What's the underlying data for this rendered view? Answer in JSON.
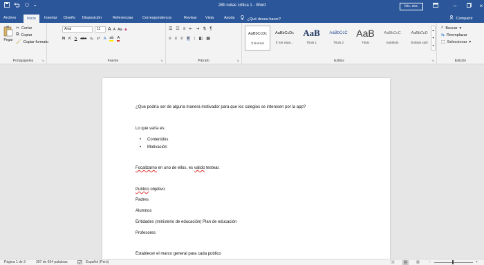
{
  "title_bar": {
    "document_title": "28h notas crítica 1 - Word",
    "signin_label": "Inic. ses.",
    "qat_icons": [
      "save-icon",
      "undo-icon",
      "redo-icon",
      "customize-icon"
    ],
    "window_controls": [
      "ribbon-display-icon",
      "minimize-icon",
      "maximize-icon",
      "close-icon"
    ]
  },
  "tabs": {
    "items": [
      "Archivo",
      "Inicio",
      "Insertar",
      "Diseño",
      "Disposición",
      "Referencias",
      "Correspondencia",
      "Revisar",
      "Vista",
      "Ayuda"
    ],
    "active": "Inicio",
    "tell_me": "¿Qué desea hacer?",
    "share": "Compartir"
  },
  "ribbon": {
    "clipboard": {
      "paste": "Pegar",
      "cut": "Cortar",
      "copy": "Copiar",
      "format_painter": "Copiar formato",
      "label": "Portapapeles"
    },
    "font": {
      "font_name": "Arial",
      "font_size": "11",
      "grow": "A",
      "shrink": "A",
      "change_case": "Aa",
      "bold": "N",
      "italic": "K",
      "underline": "S",
      "strike": "abc",
      "subscript": "x₂",
      "superscript": "x²",
      "label": "Fuente"
    },
    "paragraph": {
      "label": "Párrafo"
    },
    "styles": {
      "items": [
        {
          "preview": "AaBbCcDc",
          "name": "¶ Normal"
        },
        {
          "preview": "AaBbCcDc",
          "name": "¶ Sin espa..."
        },
        {
          "preview": "AaB",
          "name": "Título 1"
        },
        {
          "preview": "AaBbCcC",
          "name": "Título 2"
        },
        {
          "preview": "AaB",
          "name": "Título"
        },
        {
          "preview": "AaBbCcC",
          "name": "Subtítulo"
        },
        {
          "preview": "AaBbCcD",
          "name": "Énfasis sutil"
        }
      ],
      "label": "Estilos"
    },
    "editing": {
      "find": "Buscar",
      "replace": "Reemplazar",
      "select": "Seleccionar",
      "label": "Edición"
    }
  },
  "document": {
    "question": "¿Que podría ser de alguna manera motivador para que los colegios se interesen por la app?",
    "varia": "Lo que varía es:",
    "bullets": [
      "Contenidos",
      "Motivación"
    ],
    "focal_word": "Focalizarno",
    "focal_rest_1": " en uno de ellos, es ",
    "focal_valid": "valido",
    "focal_rest_2": " testear.",
    "publico_word": "Publico",
    "publico_rest": " objetivo:",
    "audience": [
      "Padres",
      "Alumnos",
      "Entidades (ministerio de educación) Plan de educación",
      "Profesores"
    ],
    "establish": "Establecer el marco general para cada publico"
  },
  "status_bar": {
    "page": "Página 1 de 3",
    "words": "397 de 654 palabras",
    "language": "Español (Perú)"
  },
  "colors": {
    "brand": "#2b579a",
    "ribbon_bg": "#f3f3f3",
    "canvas_bg": "#e6e6e6",
    "spell_error": "#e03030"
  }
}
